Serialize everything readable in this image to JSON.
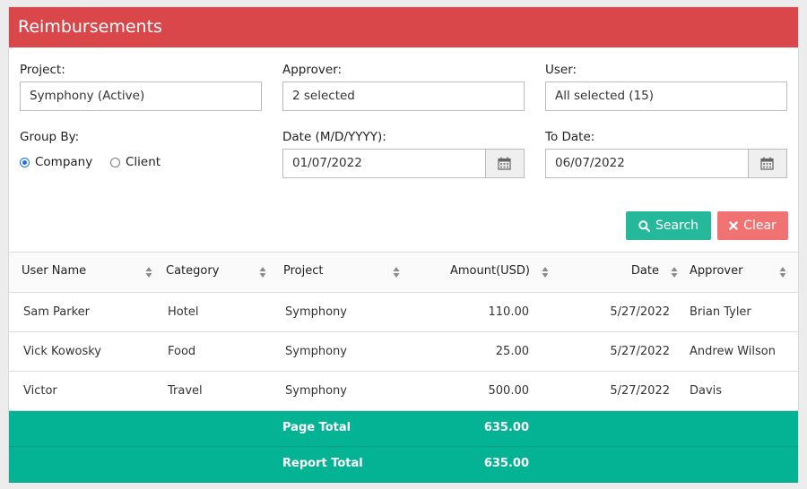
{
  "header": {
    "title": "Reimbursements"
  },
  "filters": {
    "project_label": "Project:",
    "project_value": "Symphony (Active)",
    "approver_label": "Approver:",
    "approver_value": "2 selected",
    "user_label": "User:",
    "user_value": "All selected (15)",
    "group_by_label": "Group By:",
    "group_by_options": [
      "Company",
      "Client"
    ],
    "group_by_selected": "Company",
    "from_date_label": "Date (M/D/YYYY):",
    "from_date_value": "01/07/2022",
    "to_date_label": "To Date:",
    "to_date_value": "06/07/2022"
  },
  "actions": {
    "search_label": "Search",
    "clear_label": "Clear",
    "search_color": "#25b89a",
    "clear_color": "#f07272"
  },
  "table": {
    "columns": [
      "User Name",
      "Category",
      "Project",
      "Amount(USD)",
      "Date",
      "Approver"
    ],
    "rows": [
      [
        "Sam Parker",
        "Hotel",
        "Symphony",
        "110.00",
        "5/27/2022",
        "Brian Tyler"
      ],
      [
        "Vick Kowosky",
        "Food",
        "Symphony",
        "25.00",
        "5/27/2022",
        "Andrew Wilson"
      ],
      [
        "Victor",
        "Travel",
        "Symphony",
        "500.00",
        "5/27/2022",
        "Davis"
      ]
    ],
    "totals": [
      {
        "label": "Page Total",
        "value": "635.00"
      },
      {
        "label": "Report Total",
        "value": "635.00"
      }
    ]
  },
  "icons": {
    "calendar": "calendar-icon",
    "search": "search-icon",
    "clear": "close-icon",
    "sort": "sort-icon"
  },
  "colors": {
    "header": "#d9474a",
    "total_row": "#04b394",
    "radio_selected": "#1a73e8"
  }
}
